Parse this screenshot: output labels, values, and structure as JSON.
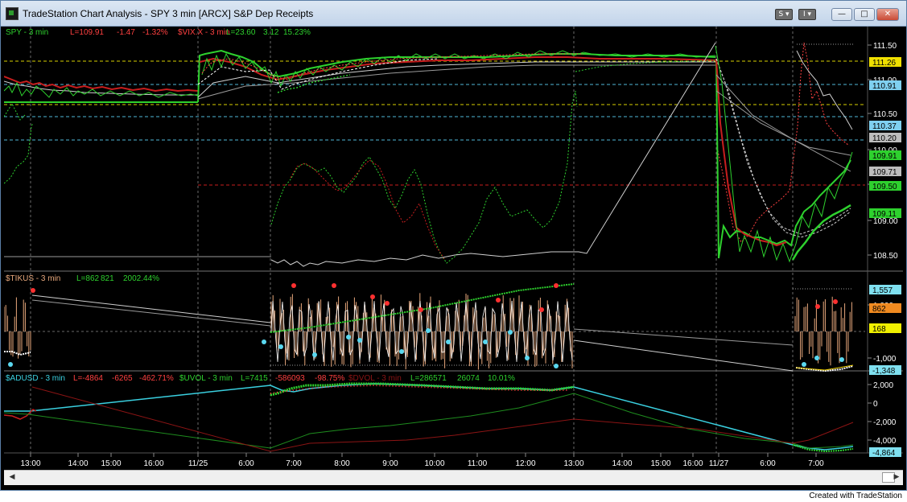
{
  "window": {
    "title": "TradeStation Chart Analysis - SPY 3 min [ARCX] S&P Dep Receipts",
    "btn_s": "S",
    "btn_i": "I",
    "credit": "Created with TradeStation"
  },
  "colors": {
    "background": "#000000",
    "spy_price": "#2ed12e",
    "vix": "#c81e1e",
    "tick": "#e8a87c",
    "adud": "#3ad0e0",
    "uvol": "#1e8c1e",
    "dvol": "#8c1414",
    "grid": "#4a4a4a"
  },
  "panels": {
    "spy": {
      "sym": "SPY - 3 min",
      "last": "L=109.91",
      "chg": "-1.47",
      "pct": "-1.32%",
      "vix_sym": "$VIX.X - 3 min",
      "vix_last": "L=23.60",
      "vix_chg": "3.12",
      "vix_pct": "15.23%",
      "axis": [
        "111.50",
        "111.00",
        "110.50",
        "110.00",
        "109.50",
        "109.00",
        "108.50"
      ],
      "tags": [
        {
          "text": "111.26",
          "bg": "#f0e000",
          "fg": "#000"
        },
        {
          "text": "110.91",
          "bg": "#7fd0f0",
          "fg": "#000"
        },
        {
          "text": "110.37",
          "bg": "#7fd0f0",
          "fg": "#000"
        },
        {
          "text": "110.20",
          "bg": "#bdbdbd",
          "fg": "#000"
        },
        {
          "text": "109.91",
          "bg": "#2ed12e",
          "fg": "#000"
        },
        {
          "text": "109.71",
          "bg": "#bdbdbd",
          "fg": "#000"
        },
        {
          "text": "109.50",
          "bg": "#2ed12e",
          "fg": "#000"
        },
        {
          "text": "109.11",
          "bg": "#2ed12e",
          "fg": "#000"
        }
      ]
    },
    "tick": {
      "sym": "$TIKUS - 3 min",
      "last": "L=862",
      "v2": "821",
      "v3": "2002.44%",
      "axis": [
        "1,000",
        "-1,000"
      ],
      "tags": [
        {
          "text": "1,557",
          "bg": "#7fe0f0",
          "fg": "#000"
        },
        {
          "text": "862",
          "bg": "#f08a20",
          "fg": "#000"
        },
        {
          "text": "168",
          "bg": "#f0f000",
          "fg": "#000"
        },
        {
          "text": "-1,348",
          "bg": "#7fe0f0",
          "fg": "#000"
        }
      ]
    },
    "breadth": {
      "sym": "$ADUSD - 3 min",
      "last": "L=-4864",
      "chg": "-6265",
      "pct": "-462.71%",
      "uvol_sym": "$UVOL - 3 min",
      "uvol_last": "L=7415",
      "uvol_chg": "-586093",
      "uvol_pct": "-98.75%",
      "dvol_sym": "$DVOL - 3 min",
      "dvol_last": "L=286571",
      "dvol_chg": "26074",
      "dvol_pct": "10.01%",
      "axis": [
        "2,000",
        "0",
        "-2,000",
        "-4,000"
      ],
      "tags": [
        {
          "text": "-4,864",
          "bg": "#7fe0f0",
          "fg": "#000"
        }
      ]
    }
  },
  "time_axis": [
    "13:00",
    "14:00",
    "15:00",
    "16:00",
    "11/25",
    "6:00",
    "7:00",
    "8:00",
    "9:00",
    "10:00",
    "11:00",
    "12:00",
    "13:00",
    "14:00",
    "15:00",
    "16:00",
    "11/27",
    "6:00",
    "7:00"
  ]
}
